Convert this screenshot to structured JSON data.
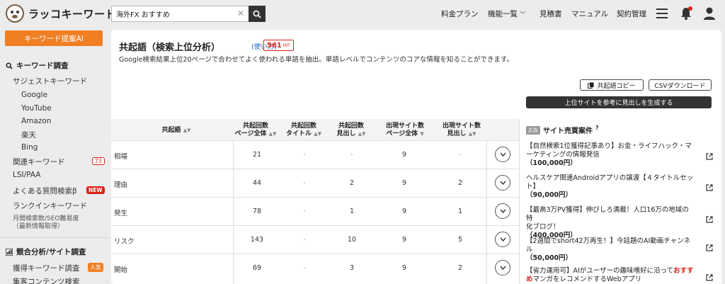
{
  "header": {
    "logo_text": "ラッコキーワード",
    "search_value": "海外FX おすすめ",
    "nav": [
      "料金プラン",
      "機能一覧",
      "見積書",
      "マニュアル",
      "契約管理"
    ]
  },
  "sidebar": {
    "cta_label": "キーワード提案AI",
    "section1": "キーワード調査",
    "suggest": "サジェストキーワード",
    "suggest_sources": [
      "Google",
      "YouTube",
      "Amazon",
      "楽天",
      "Bing"
    ],
    "related": "関連キーワード",
    "related_badge": "73",
    "lsi": "LSI/PAA",
    "faq": "よくある質問検索β",
    "faq_badge": "NEW",
    "rankin": "ランクインキーワード",
    "monthly_line1": "月間検索数/SEO難易度",
    "monthly_line2": "（最新情報取得）",
    "section2": "競合分析/サイト調査",
    "acquired": "獲得キーワード調査",
    "acquired_badge": "人気",
    "content": "集客コンテンツ検索"
  },
  "main": {
    "title": "共起語（検索上位分析）",
    "howto": "(使い方)",
    "hit_count": "561",
    "hit_unit": "HIT",
    "description": "Google検索結果上位20ページで合わせてよく使われる単語を抽出。単語レベルでコンテンツのコアな情報を知ることができます。",
    "copy_label": "共起語コピー",
    "csv_label": "CSVダウンロード",
    "generate_label": "上位サイトを参考に見出しを生成する"
  },
  "table": {
    "headers": [
      {
        "l1": "共起語",
        "l2": ""
      },
      {
        "l1": "共起回数",
        "l2": "ページ全体"
      },
      {
        "l1": "共起回数",
        "l2": "タイトル"
      },
      {
        "l1": "共起回数",
        "l2": "見出し"
      },
      {
        "l1": "出現サイト数",
        "l2": "ページ全体"
      },
      {
        "l1": "出現サイト数",
        "l2": "見出し"
      }
    ],
    "rows": [
      {
        "word": "相場",
        "page": "21",
        "title": "-",
        "heading": "-",
        "sites_page": "9",
        "sites_heading": "-"
      },
      {
        "word": "理由",
        "page": "44",
        "title": "-",
        "heading": "2",
        "sites_page": "9",
        "sites_heading": "2"
      },
      {
        "word": "発生",
        "page": "78",
        "title": "-",
        "heading": "1",
        "sites_page": "9",
        "sites_heading": "1"
      },
      {
        "word": "リスク",
        "page": "143",
        "title": "-",
        "heading": "10",
        "sites_page": "9",
        "sites_heading": "5"
      },
      {
        "word": "開始",
        "page": "69",
        "title": "-",
        "heading": "3",
        "sites_page": "9",
        "sites_heading": "2"
      }
    ]
  },
  "ads": {
    "tag": "広告",
    "title": "サイト売買案件",
    "items": [
      {
        "l1": "【自然検索1位獲得記事あり】お金・ライフハック・マ",
        "l2": "ーケティングの情報発信",
        "price": "（100,000円）"
      },
      {
        "l1": "ヘルスケア関連Androidアプリの譲渡【４タイトルセッ",
        "l2": "ト】",
        "price": "（90,000円）"
      },
      {
        "l1": "【最高3万PV獲得】伸びしろ満載！人口16万の地域の特",
        "l2": "化ブログ！",
        "price": "（400,000円）"
      },
      {
        "l1": "【2週間でshort42万再生！】今話題のAI動画チャンネル",
        "l2": "",
        "price": "（50,000円）"
      },
      {
        "l1a": "【省力運用可】AIがユーザーの趣味嗜好に沿って",
        "l1b": "おすす",
        "l2a": "め",
        "l2b": "マンガをレコメンドするWebアプリ"
      }
    ]
  },
  "colors": {
    "accent": "#f07f23",
    "danger": "#d9231d",
    "link": "#1a5fb4",
    "dark": "#333333"
  }
}
